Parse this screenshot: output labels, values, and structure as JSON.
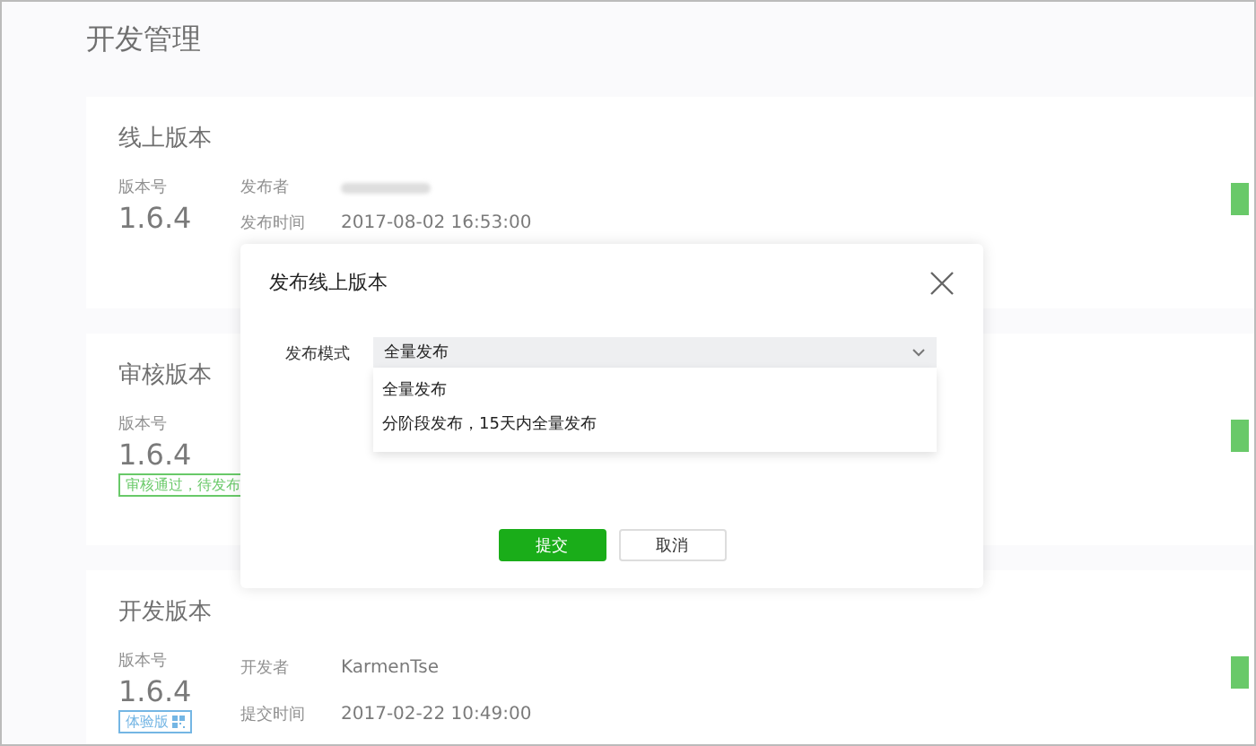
{
  "page_title": "开发管理",
  "cards": [
    {
      "title": "线上版本",
      "version_label": "版本号",
      "version": "1.6.4",
      "fields": [
        {
          "label": "发布者",
          "kind": "blurred"
        },
        {
          "label": "发布时间",
          "kind": "text",
          "value": "2017-08-02 16:53:00"
        }
      ]
    },
    {
      "title": "审核版本",
      "version_label": "版本号",
      "version": "1.6.4",
      "badge": {
        "text": "审核通过，待发布",
        "kind": "success"
      }
    },
    {
      "title": "开发版本",
      "version_label": "版本号",
      "version": "1.6.4",
      "badge": {
        "text": "体验版",
        "kind": "trial"
      },
      "fields": [
        {
          "label": "开发者",
          "kind": "text",
          "value": "KarmenTse"
        },
        {
          "label": "提交时间",
          "kind": "text",
          "value": "2017-02-22 10:49:00"
        }
      ]
    }
  ],
  "dialog": {
    "title": "发布线上版本",
    "field_label": "发布模式",
    "select_value": "全量发布",
    "options": [
      "全量发布",
      "分阶段发布，15天内全量发布"
    ],
    "buttons": [
      {
        "label": "提交",
        "kind": "primary"
      },
      {
        "label": "取消",
        "kind": "default"
      }
    ]
  }
}
